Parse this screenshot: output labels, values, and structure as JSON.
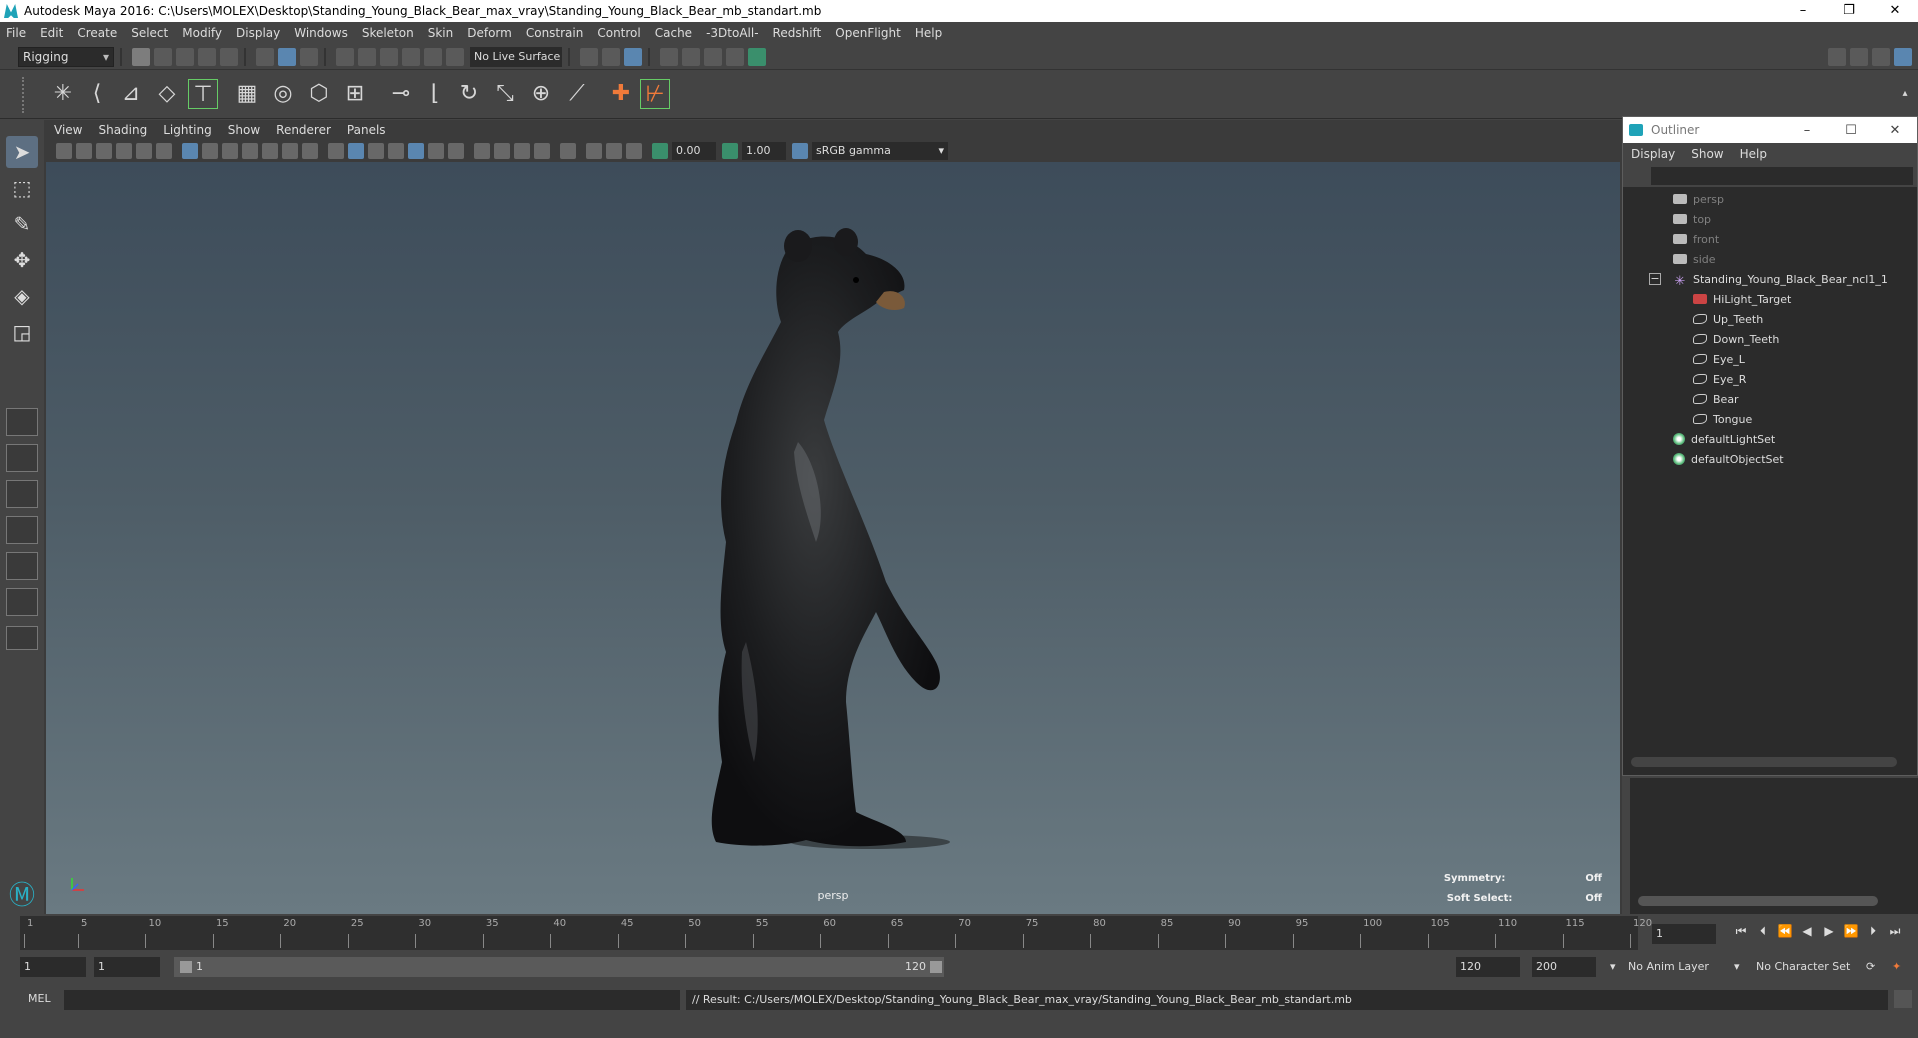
{
  "window": {
    "title": "Autodesk Maya 2016: C:\\Users\\MOLEX\\Desktop\\Standing_Young_Black_Bear_max_vray\\Standing_Young_Black_Bear_mb_standart.mb",
    "minimize": "–",
    "restore": "❐",
    "close": "✕"
  },
  "menu": [
    "File",
    "Edit",
    "Create",
    "Select",
    "Modify",
    "Display",
    "Windows",
    "Skeleton",
    "Skin",
    "Deform",
    "Constrain",
    "Control",
    "Cache",
    "-3DtoAll-",
    "Redshift",
    "OpenFlight",
    "Help"
  ],
  "status": {
    "mode": "Rigging",
    "live_surface": "No Live Surface"
  },
  "panel": {
    "menu": [
      "View",
      "Shading",
      "Lighting",
      "Show",
      "Renderer",
      "Panels"
    ],
    "exposure": "0.00",
    "gamma_value": "1.00",
    "color_space": "sRGB gamma"
  },
  "viewport": {
    "camera_label": "persp",
    "symmetry_label": "Symmetry:",
    "symmetry_value": "Off",
    "soft_select_label": "Soft Select:",
    "soft_select_value": "Off"
  },
  "outliner": {
    "title": "Outliner",
    "menu": [
      "Display",
      "Show",
      "Help"
    ],
    "items": [
      {
        "label": "persp",
        "icon": "camera-icon",
        "dim": true
      },
      {
        "label": "top",
        "icon": "camera-icon",
        "dim": true
      },
      {
        "label": "front",
        "icon": "camera-icon",
        "dim": true
      },
      {
        "label": "side",
        "icon": "camera-icon",
        "dim": true
      },
      {
        "label": "Standing_Young_Black_Bear_ncl1_1",
        "icon": "joint-icon",
        "dim": false
      },
      {
        "label": "HiLight_Target",
        "icon": "target-icon",
        "dim": false
      },
      {
        "label": "Up_Teeth",
        "icon": "mesh-icon",
        "dim": false
      },
      {
        "label": "Down_Teeth",
        "icon": "mesh-icon",
        "dim": false
      },
      {
        "label": "Eye_L",
        "icon": "mesh-icon",
        "dim": false
      },
      {
        "label": "Eye_R",
        "icon": "mesh-icon",
        "dim": false
      },
      {
        "label": "Bear",
        "icon": "mesh-icon",
        "dim": false
      },
      {
        "label": "Tongue",
        "icon": "mesh-icon",
        "dim": false
      },
      {
        "label": "defaultLightSet",
        "icon": "set-icon",
        "dim": false
      },
      {
        "label": "defaultObjectSet",
        "icon": "set-icon",
        "dim": false
      }
    ]
  },
  "timeline": {
    "ticks": [
      "1",
      "5",
      "10",
      "15",
      "20",
      "25",
      "30",
      "35",
      "40",
      "45",
      "50",
      "55",
      "60",
      "65",
      "70",
      "75",
      "80",
      "85",
      "90",
      "95",
      "100",
      "105",
      "110",
      "115",
      "120"
    ],
    "current_frame": "1"
  },
  "range": {
    "start": "1",
    "playback_start": "1",
    "slider_start": "1",
    "slider_end": "120",
    "playback_end": "120",
    "end": "200",
    "anim_layer": "No Anim Layer",
    "character_set": "No Character Set"
  },
  "command": {
    "mode": "MEL",
    "result": "// Result: C:/Users/MOLEX/Desktop/Standing_Young_Black_Bear_max_vray/Standing_Young_Black_Bear_mb_standart.mb"
  }
}
